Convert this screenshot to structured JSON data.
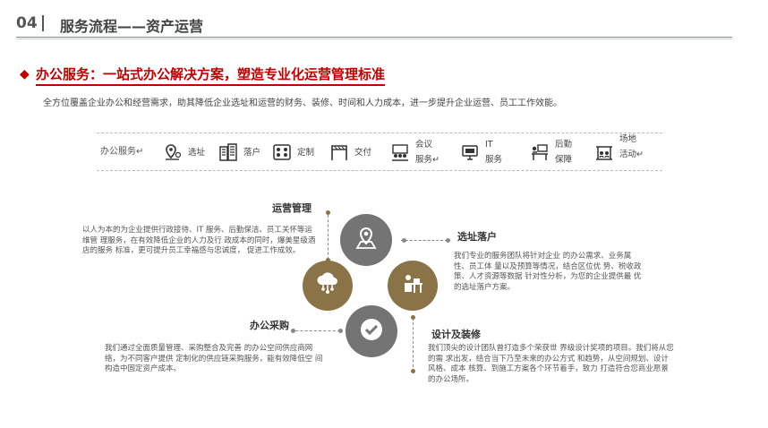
{
  "header": {
    "number": "04",
    "title": "服务流程——资产运营"
  },
  "section": {
    "title": "办公服务：一站式办公解决方案，塑造专业化运营管理标准",
    "intro": "全方位覆盖企业办公和经营需求，助其降低企业选址和运营的财务、装修、时间和人力成本，进一步提升企业运营、员工工作效能。"
  },
  "strip": {
    "label": "办公服务↵",
    "items": [
      {
        "icon": "location-pin-icon",
        "label": "选址"
      },
      {
        "icon": "building-icon",
        "label": "落户"
      },
      {
        "icon": "layout-icon",
        "label": "定制"
      },
      {
        "icon": "gate-icon",
        "label": "交付"
      },
      {
        "icon": "meeting-icon",
        "label_1": "会议",
        "label_2": "服务↵"
      },
      {
        "icon": "computer-icon",
        "label_1": "IT",
        "label_2": "服务"
      },
      {
        "icon": "desk-icon",
        "label_1": "后勤",
        "label_2": "保障"
      },
      {
        "icon": "venue-icon",
        "label_1": "场地",
        "label_2": "活动↵"
      }
    ]
  },
  "blocks": {
    "ops": {
      "title": "运营管理",
      "text": "以人为本的为企业提供行政接待、IT 服务、后勤保洁、员工关怀等运维管 理服务，在有效降低企业的人力及行 政成本的同时，爆美星级酒店的服务 标准，更可提升员工幸福感与忠诚度， 促进工作成效。"
    },
    "site": {
      "title": "选址落户",
      "text": "我们专业的服务团队将针对企业 的办公需求、业务属性、员工体 量以及预算等情况，结合区位优 势、税收政策、人才资源等数据 针对性分析，为您的企业提供最 优的选址落户方案。"
    },
    "purchase": {
      "title": "办公采购",
      "text": "我们通过全面质量管理、采购整合及完善 的办公空间供应商网络，为不同客户提供 定制化的供应链采购服务，能有效降低空 间构造中固定资产成本。"
    },
    "design": {
      "title": "设计及装修",
      "text": "我们顶尖的设计团队曾打造多个荣获世 界级设计奖项的项目。我们将从您的需 求出发，结合当下乃至未来的办公方式 和趋势，从空间规划、设计风格、成本 核算、到施工方案各个环节着手，致力 打造符合您商业愿景的办公场所。"
    }
  },
  "colors": {
    "accent_red": "#c00000",
    "gold": "#8a7346",
    "gray": "#747474"
  }
}
